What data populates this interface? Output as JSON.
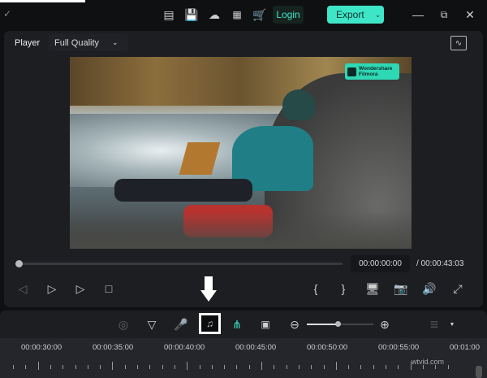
{
  "topbar": {
    "login_label": "Login",
    "export_label": "Export"
  },
  "player": {
    "label": "Player",
    "quality": "Full Quality",
    "current_time": "00:00:00:00",
    "total_time": "/ 00:00:43:03",
    "progress": 0
  },
  "video": {
    "badge_brand": "Wondershare",
    "badge_product": "Filmora"
  },
  "timeline": {
    "zoom_level": 0.4,
    "ruler_labels": [
      "00:00:30:00",
      "00:00:35:00",
      "00:00:40:00",
      "00:00:45:00",
      "00:00:50:00",
      "00:00:55:00",
      "00:01:00"
    ]
  },
  "watermark": "wtvid.com",
  "colors": {
    "accent": "#3ee6c8",
    "cart": "#e0457b"
  }
}
